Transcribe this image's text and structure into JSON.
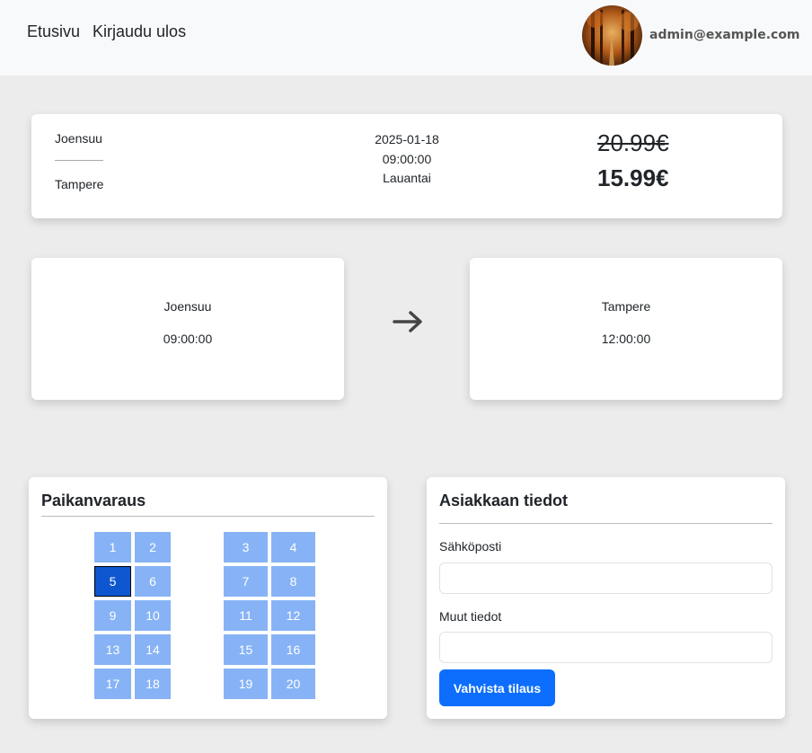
{
  "nav": {
    "home": "Etusivu",
    "logout": "Kirjaudu ulos",
    "user_email": "admin@example.com"
  },
  "trip": {
    "from": "Joensuu",
    "to": "Tampere",
    "date": "2025-01-18",
    "time": "09:00:00",
    "weekday": "Lauantai",
    "old_price": "20.99€",
    "new_price": "15.99€"
  },
  "departure": {
    "city": "Joensuu",
    "time": "09:00:00"
  },
  "arrival": {
    "city": "Tampere",
    "time": "12:00:00"
  },
  "seats": {
    "title": "Paikanvaraus",
    "labels": [
      "1",
      "2",
      "3",
      "4",
      "5",
      "6",
      "7",
      "8",
      "9",
      "10",
      "11",
      "12",
      "13",
      "14",
      "15",
      "16",
      "17",
      "18",
      "19",
      "20"
    ],
    "selected": "5"
  },
  "customer": {
    "title": "Asiakkaan tiedot",
    "email_label": "Sähköposti",
    "email_value": "",
    "other_label": "Muut tiedot",
    "other_value": "",
    "submit": "Vahvista tilaus"
  },
  "colors": {
    "seat": "#87b3f6",
    "seat_selected": "#0d56d0",
    "primary": "#0d6efd"
  }
}
